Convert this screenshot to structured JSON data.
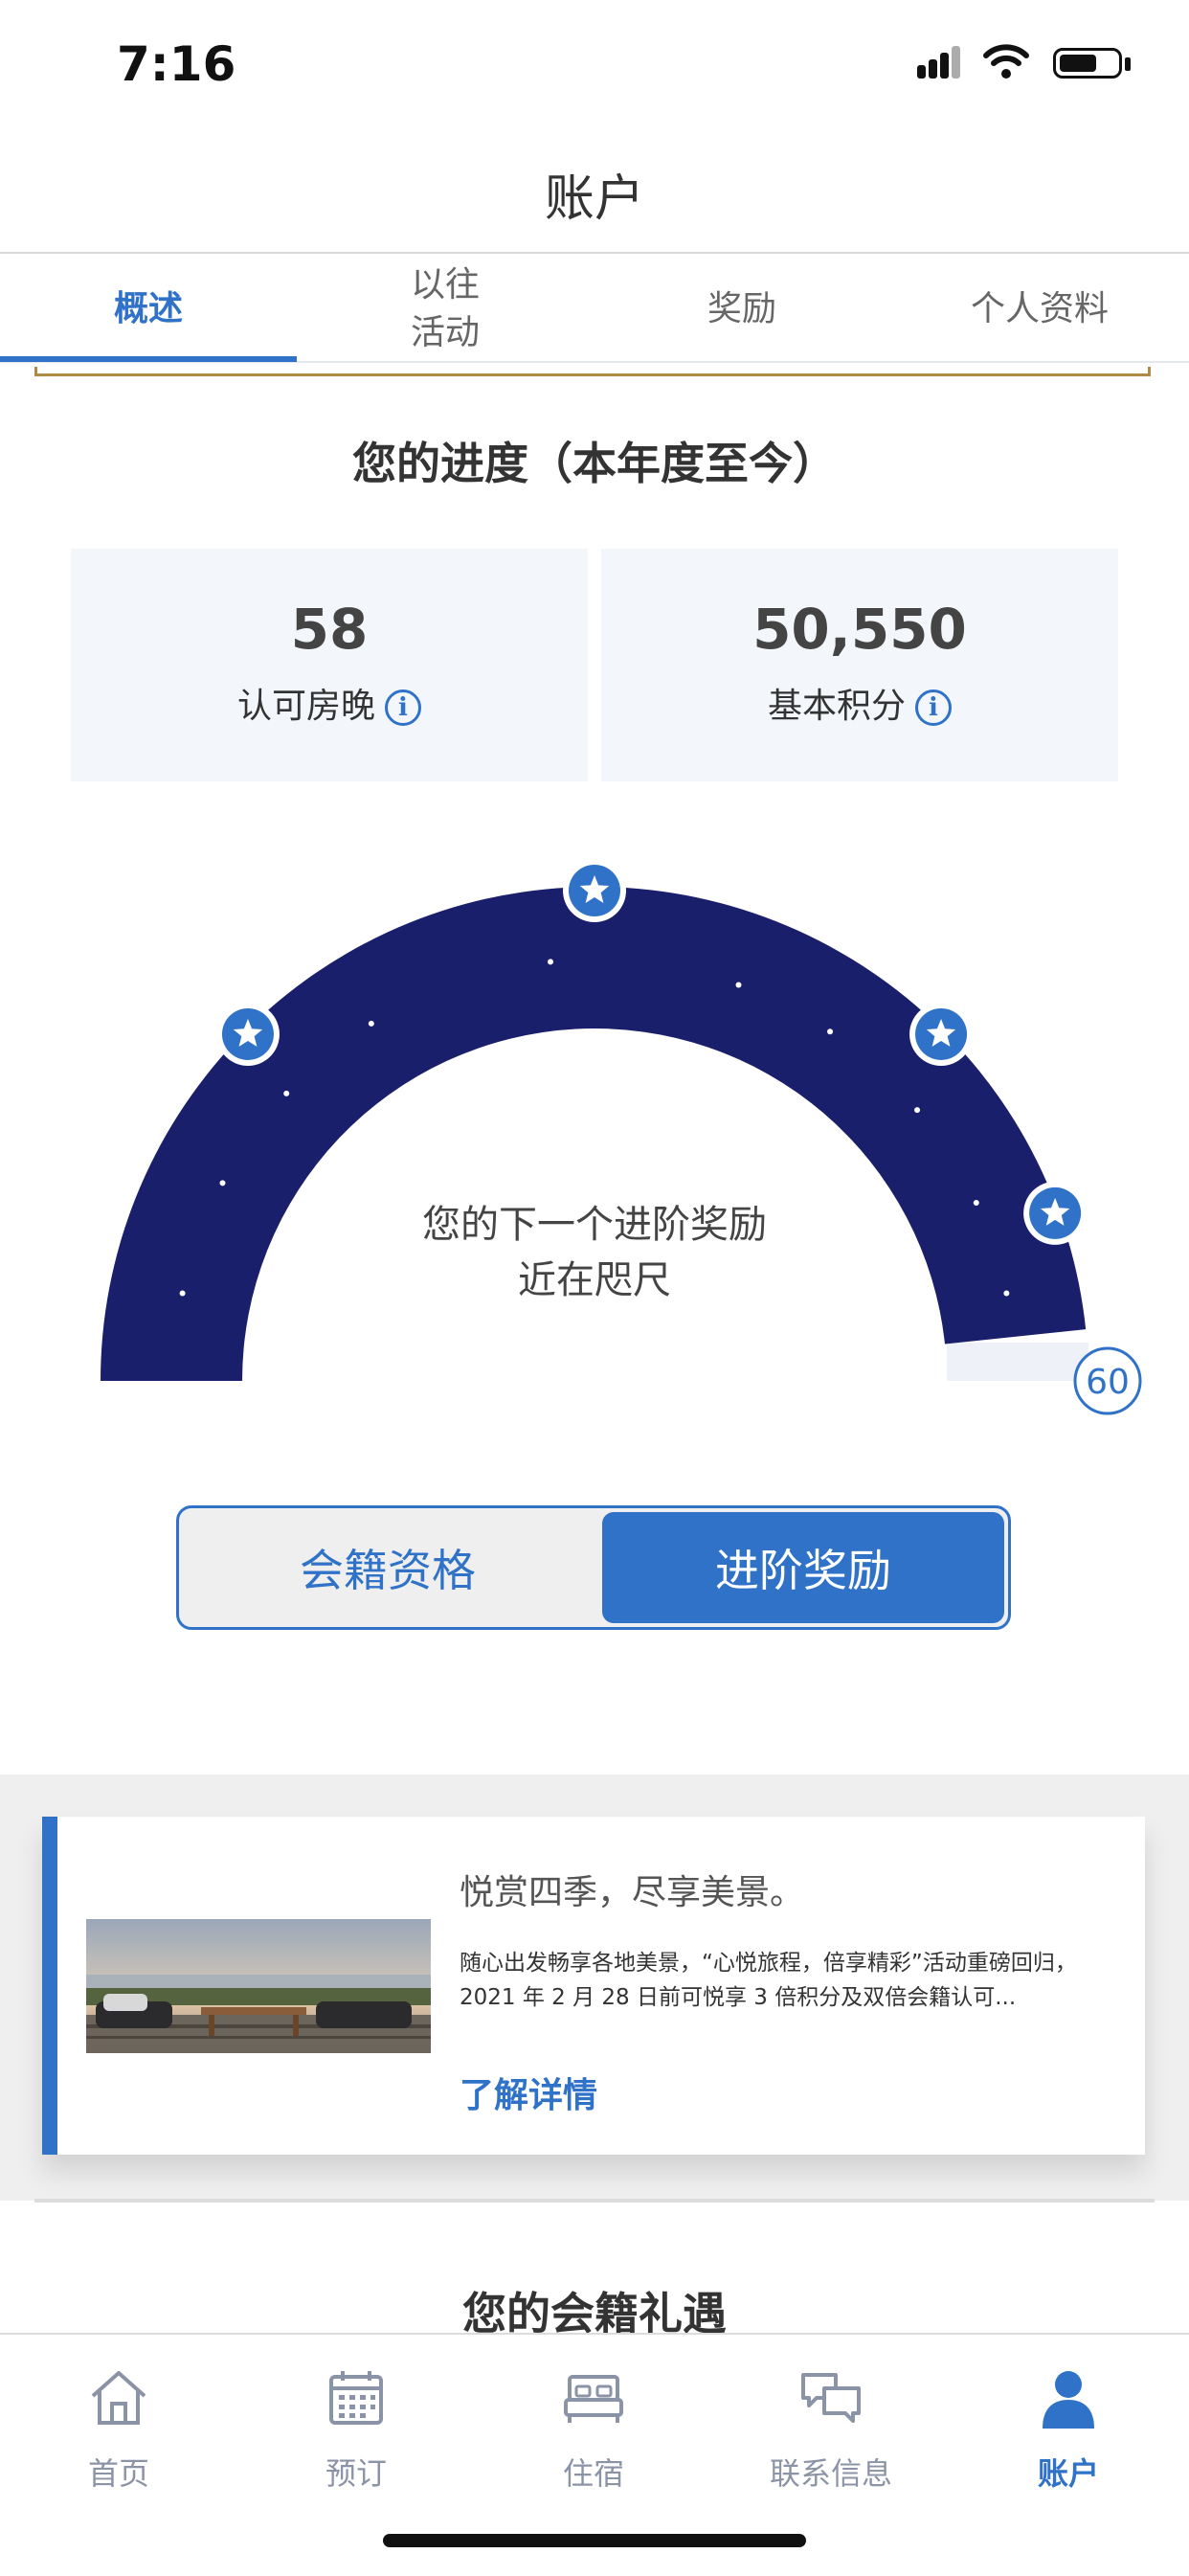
{
  "status_bar": {
    "time": "7:16"
  },
  "header": {
    "title": "账户"
  },
  "tabs": [
    {
      "label": "概述",
      "active": true
    },
    {
      "label": "以往\n活动",
      "active": false
    },
    {
      "label": "奖励",
      "active": false
    },
    {
      "label": "个人资料",
      "active": false
    }
  ],
  "progress": {
    "title": "您的进度（本年度至今）",
    "stats": [
      {
        "value": "58",
        "label": "认可房晚",
        "info_icon": "info-icon"
      },
      {
        "value": "50,550",
        "label": "基本积分",
        "info_icon": "info-icon"
      }
    ],
    "gauge": {
      "message_line1": "您的下一个进阶奖励",
      "message_line2": "近在咫尺",
      "max_label": "60",
      "current_nights": 58,
      "max_nights": 60,
      "fill_color": "#1a1f6b",
      "milestone_icon": "star-icon"
    }
  },
  "segment": {
    "left_label": "会籍资格",
    "right_label": "进阶奖励",
    "selected": "right"
  },
  "promo": {
    "title": "悦赏四季，尽享美景。",
    "text": "随心出发畅享各地美景，“心悦旅程，倍享精彩”活动重磅回归，2021 年 2 月 28 日前可悦享 3 倍积分及双倍会籍认可...",
    "link": "了解详情"
  },
  "benefits": {
    "title": "您的会籍礼遇"
  },
  "bottom_nav": [
    {
      "label": "首页",
      "icon": "home-icon",
      "active": false
    },
    {
      "label": "预订",
      "icon": "calendar-icon",
      "active": false
    },
    {
      "label": "住宿",
      "icon": "bed-icon",
      "active": false
    },
    {
      "label": "联系信息",
      "icon": "chat-icon",
      "active": false
    },
    {
      "label": "账户",
      "icon": "person-icon",
      "active": true
    }
  ],
  "colors": {
    "accent": "#2f72c8",
    "gauge_fill": "#1a1f6b",
    "gold": "#b08a45"
  }
}
